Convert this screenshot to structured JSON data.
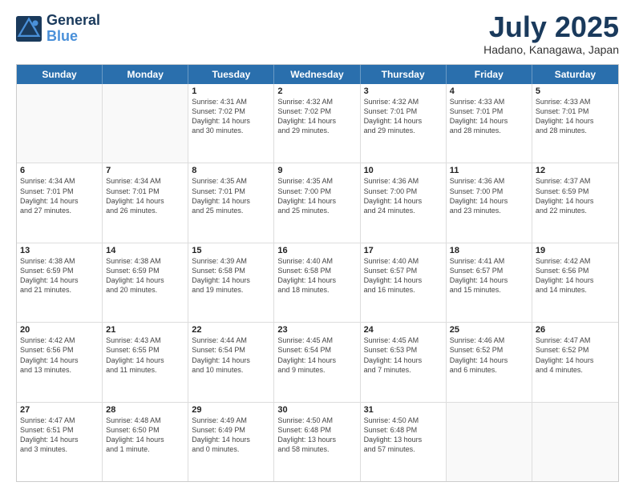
{
  "header": {
    "logo_line1": "General",
    "logo_line2": "Blue",
    "month_title": "July 2025",
    "location": "Hadano, Kanagawa, Japan"
  },
  "weekdays": [
    "Sunday",
    "Monday",
    "Tuesday",
    "Wednesday",
    "Thursday",
    "Friday",
    "Saturday"
  ],
  "rows": [
    [
      {
        "day": "",
        "info": ""
      },
      {
        "day": "",
        "info": ""
      },
      {
        "day": "1",
        "info": "Sunrise: 4:31 AM\nSunset: 7:02 PM\nDaylight: 14 hours\nand 30 minutes."
      },
      {
        "day": "2",
        "info": "Sunrise: 4:32 AM\nSunset: 7:02 PM\nDaylight: 14 hours\nand 29 minutes."
      },
      {
        "day": "3",
        "info": "Sunrise: 4:32 AM\nSunset: 7:01 PM\nDaylight: 14 hours\nand 29 minutes."
      },
      {
        "day": "4",
        "info": "Sunrise: 4:33 AM\nSunset: 7:01 PM\nDaylight: 14 hours\nand 28 minutes."
      },
      {
        "day": "5",
        "info": "Sunrise: 4:33 AM\nSunset: 7:01 PM\nDaylight: 14 hours\nand 28 minutes."
      }
    ],
    [
      {
        "day": "6",
        "info": "Sunrise: 4:34 AM\nSunset: 7:01 PM\nDaylight: 14 hours\nand 27 minutes."
      },
      {
        "day": "7",
        "info": "Sunrise: 4:34 AM\nSunset: 7:01 PM\nDaylight: 14 hours\nand 26 minutes."
      },
      {
        "day": "8",
        "info": "Sunrise: 4:35 AM\nSunset: 7:01 PM\nDaylight: 14 hours\nand 25 minutes."
      },
      {
        "day": "9",
        "info": "Sunrise: 4:35 AM\nSunset: 7:00 PM\nDaylight: 14 hours\nand 25 minutes."
      },
      {
        "day": "10",
        "info": "Sunrise: 4:36 AM\nSunset: 7:00 PM\nDaylight: 14 hours\nand 24 minutes."
      },
      {
        "day": "11",
        "info": "Sunrise: 4:36 AM\nSunset: 7:00 PM\nDaylight: 14 hours\nand 23 minutes."
      },
      {
        "day": "12",
        "info": "Sunrise: 4:37 AM\nSunset: 6:59 PM\nDaylight: 14 hours\nand 22 minutes."
      }
    ],
    [
      {
        "day": "13",
        "info": "Sunrise: 4:38 AM\nSunset: 6:59 PM\nDaylight: 14 hours\nand 21 minutes."
      },
      {
        "day": "14",
        "info": "Sunrise: 4:38 AM\nSunset: 6:59 PM\nDaylight: 14 hours\nand 20 minutes."
      },
      {
        "day": "15",
        "info": "Sunrise: 4:39 AM\nSunset: 6:58 PM\nDaylight: 14 hours\nand 19 minutes."
      },
      {
        "day": "16",
        "info": "Sunrise: 4:40 AM\nSunset: 6:58 PM\nDaylight: 14 hours\nand 18 minutes."
      },
      {
        "day": "17",
        "info": "Sunrise: 4:40 AM\nSunset: 6:57 PM\nDaylight: 14 hours\nand 16 minutes."
      },
      {
        "day": "18",
        "info": "Sunrise: 4:41 AM\nSunset: 6:57 PM\nDaylight: 14 hours\nand 15 minutes."
      },
      {
        "day": "19",
        "info": "Sunrise: 4:42 AM\nSunset: 6:56 PM\nDaylight: 14 hours\nand 14 minutes."
      }
    ],
    [
      {
        "day": "20",
        "info": "Sunrise: 4:42 AM\nSunset: 6:56 PM\nDaylight: 14 hours\nand 13 minutes."
      },
      {
        "day": "21",
        "info": "Sunrise: 4:43 AM\nSunset: 6:55 PM\nDaylight: 14 hours\nand 11 minutes."
      },
      {
        "day": "22",
        "info": "Sunrise: 4:44 AM\nSunset: 6:54 PM\nDaylight: 14 hours\nand 10 minutes."
      },
      {
        "day": "23",
        "info": "Sunrise: 4:45 AM\nSunset: 6:54 PM\nDaylight: 14 hours\nand 9 minutes."
      },
      {
        "day": "24",
        "info": "Sunrise: 4:45 AM\nSunset: 6:53 PM\nDaylight: 14 hours\nand 7 minutes."
      },
      {
        "day": "25",
        "info": "Sunrise: 4:46 AM\nSunset: 6:52 PM\nDaylight: 14 hours\nand 6 minutes."
      },
      {
        "day": "26",
        "info": "Sunrise: 4:47 AM\nSunset: 6:52 PM\nDaylight: 14 hours\nand 4 minutes."
      }
    ],
    [
      {
        "day": "27",
        "info": "Sunrise: 4:47 AM\nSunset: 6:51 PM\nDaylight: 14 hours\nand 3 minutes."
      },
      {
        "day": "28",
        "info": "Sunrise: 4:48 AM\nSunset: 6:50 PM\nDaylight: 14 hours\nand 1 minute."
      },
      {
        "day": "29",
        "info": "Sunrise: 4:49 AM\nSunset: 6:49 PM\nDaylight: 14 hours\nand 0 minutes."
      },
      {
        "day": "30",
        "info": "Sunrise: 4:50 AM\nSunset: 6:48 PM\nDaylight: 13 hours\nand 58 minutes."
      },
      {
        "day": "31",
        "info": "Sunrise: 4:50 AM\nSunset: 6:48 PM\nDaylight: 13 hours\nand 57 minutes."
      },
      {
        "day": "",
        "info": ""
      },
      {
        "day": "",
        "info": ""
      }
    ]
  ]
}
